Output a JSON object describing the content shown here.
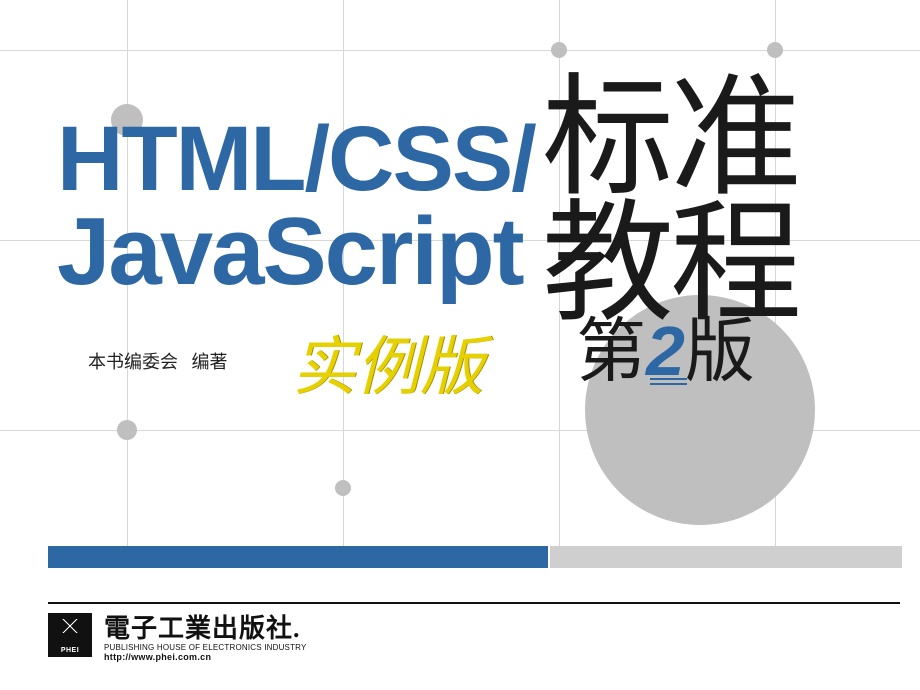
{
  "title_en_line1": "HTML/CSS/",
  "title_en_line2": "JavaScript",
  "title_cn_1": "标准",
  "title_cn_2": "教程",
  "example_edition": "实例版",
  "edition_prefix": "第",
  "edition_number": "2",
  "edition_suffix": "版",
  "author_label": "本书编委会",
  "author_role": "编著",
  "publisher_name": "電子工業出版社.",
  "publisher_en": "PUBLISHING HOUSE OF ELECTRONICS INDUSTRY",
  "publisher_url": "http://www.phei.com.cn",
  "logo_text": "PHEI",
  "colors": {
    "blue": "#2d68a5",
    "grey_node": "#bfbfbf",
    "yellow": "#e6d100"
  }
}
